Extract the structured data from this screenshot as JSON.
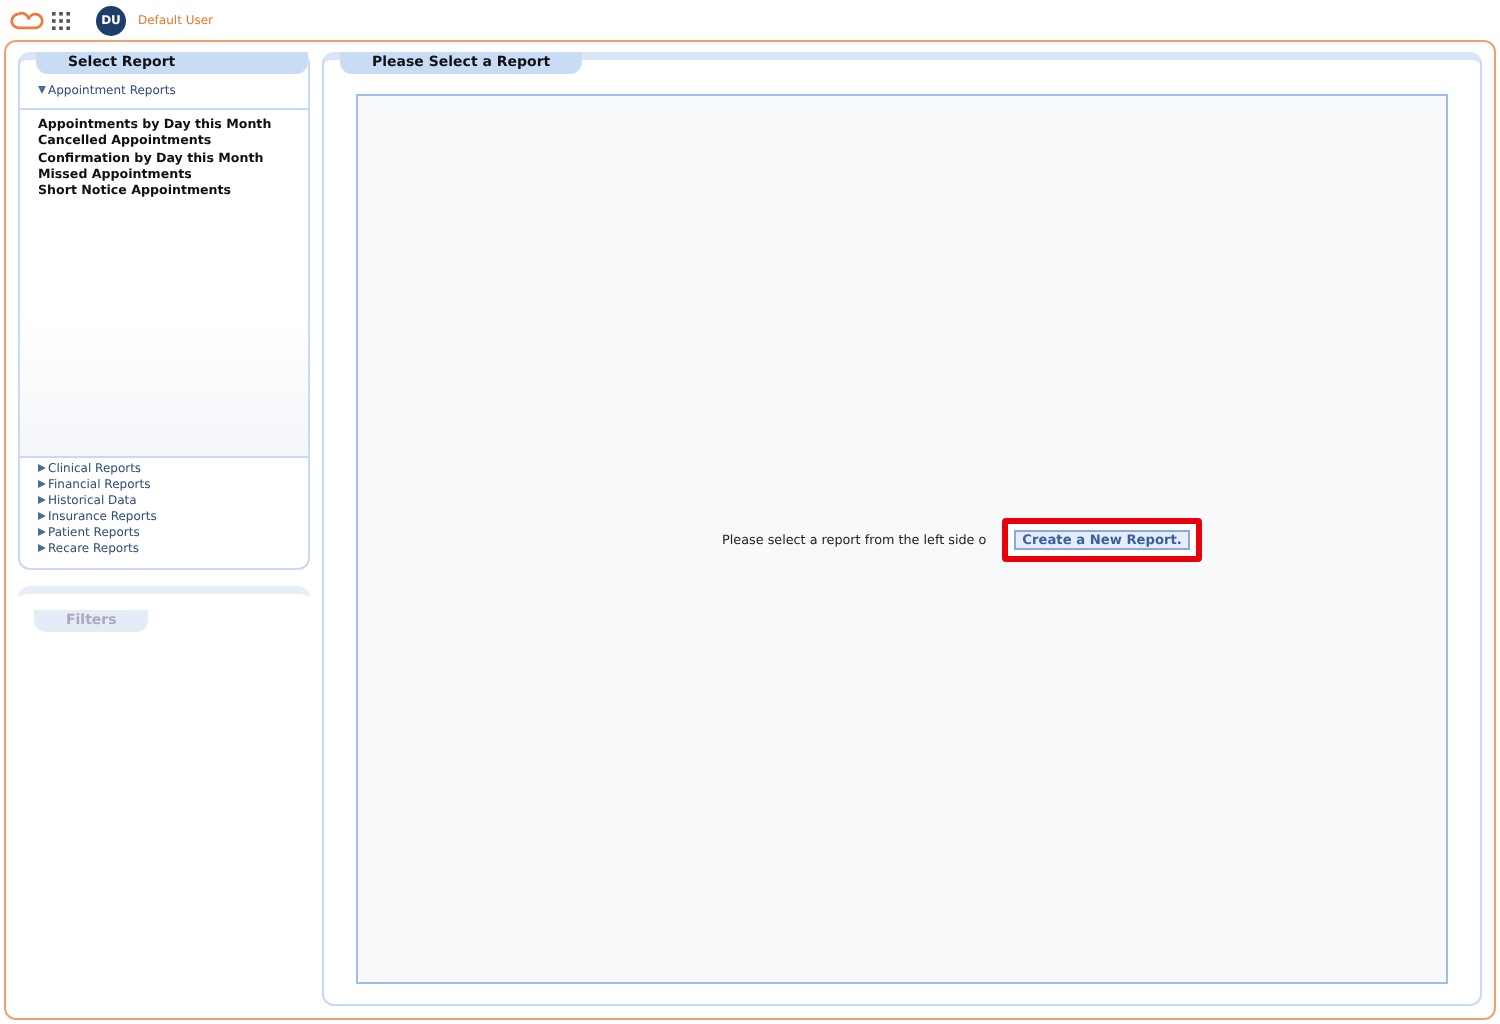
{
  "header": {
    "avatar": "DU",
    "user": "Default User"
  },
  "select_report": {
    "title": "Select Report",
    "open_group": {
      "label": "Appointment Reports",
      "expanded": true,
      "children": [
        "Appointments by Day this Month",
        "Cancelled Appointments",
        "Confirmation by Day this Month",
        "Missed Appointments",
        "Short Notice Appointments"
      ]
    },
    "groups": [
      {
        "label": "Clinical Reports",
        "expanded": false
      },
      {
        "label": "Financial Reports",
        "expanded": false
      },
      {
        "label": "Historical Data",
        "expanded": false
      },
      {
        "label": "Insurance Reports",
        "expanded": false
      },
      {
        "label": "Patient Reports",
        "expanded": false
      },
      {
        "label": "Recare Reports",
        "expanded": false
      }
    ]
  },
  "filters": {
    "title": "Filters",
    "disabled": true
  },
  "main": {
    "title": "Please Select a Report",
    "message": "Please select a report from the left side o",
    "button": "Create a New Report.",
    "highlighted": true
  }
}
